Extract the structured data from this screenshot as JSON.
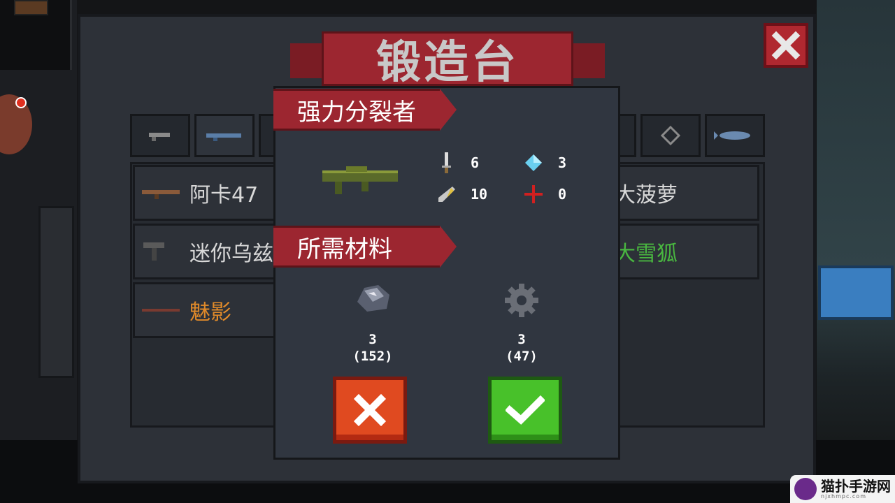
{
  "forge": {
    "title": "锻造台",
    "close_icon": "close-x-icon",
    "tabs": [
      {
        "icon": "pistol-icon"
      },
      {
        "icon": "rifle-icon"
      },
      {
        "icon": "shotgun-icon"
      },
      {
        "icon": "laser-gun-icon"
      },
      {
        "icon": "crosshair-icon"
      },
      {
        "icon": "fish-icon"
      }
    ],
    "weapons": [
      {
        "name": "阿卡47",
        "color": "#d8d8d8",
        "icon": "ak47-icon"
      },
      {
        "name": "迷你乌兹",
        "color": "#d8d8d8",
        "icon": "uzi-icon"
      },
      {
        "name": "魅影",
        "color": "#e08a2a",
        "icon": "phantom-rifle-icon"
      },
      {
        "name": "大菠萝",
        "color": "#d8d8d8"
      },
      {
        "name": "大雪狐",
        "color": "#49b640"
      }
    ]
  },
  "detail": {
    "weapon_name": "强力分裂者",
    "weapon_icon": "rocket-launcher-icon",
    "stats": [
      {
        "icon": "sword-icon",
        "value": "6"
      },
      {
        "icon": "energy-crystal-icon",
        "value": "3"
      },
      {
        "icon": "feather-pen-icon",
        "value": "10"
      },
      {
        "icon": "red-crosshair-icon",
        "value": "0"
      }
    ],
    "materials_title": "所需材料",
    "materials": [
      {
        "icon": "iron-ore-icon",
        "required": "3",
        "owned": "(152)"
      },
      {
        "icon": "gear-icon",
        "required": "3",
        "owned": "(47)"
      }
    ],
    "cancel_icon": "cancel-x-icon",
    "confirm_icon": "confirm-check-icon"
  },
  "watermark": {
    "text": "猫扑手游网",
    "sub": "njxhmpc.com"
  },
  "colors": {
    "ribbon": "#9c2630",
    "confirm": "#48c12a",
    "cancel": "#e04a20",
    "panel": "#2d3138"
  }
}
